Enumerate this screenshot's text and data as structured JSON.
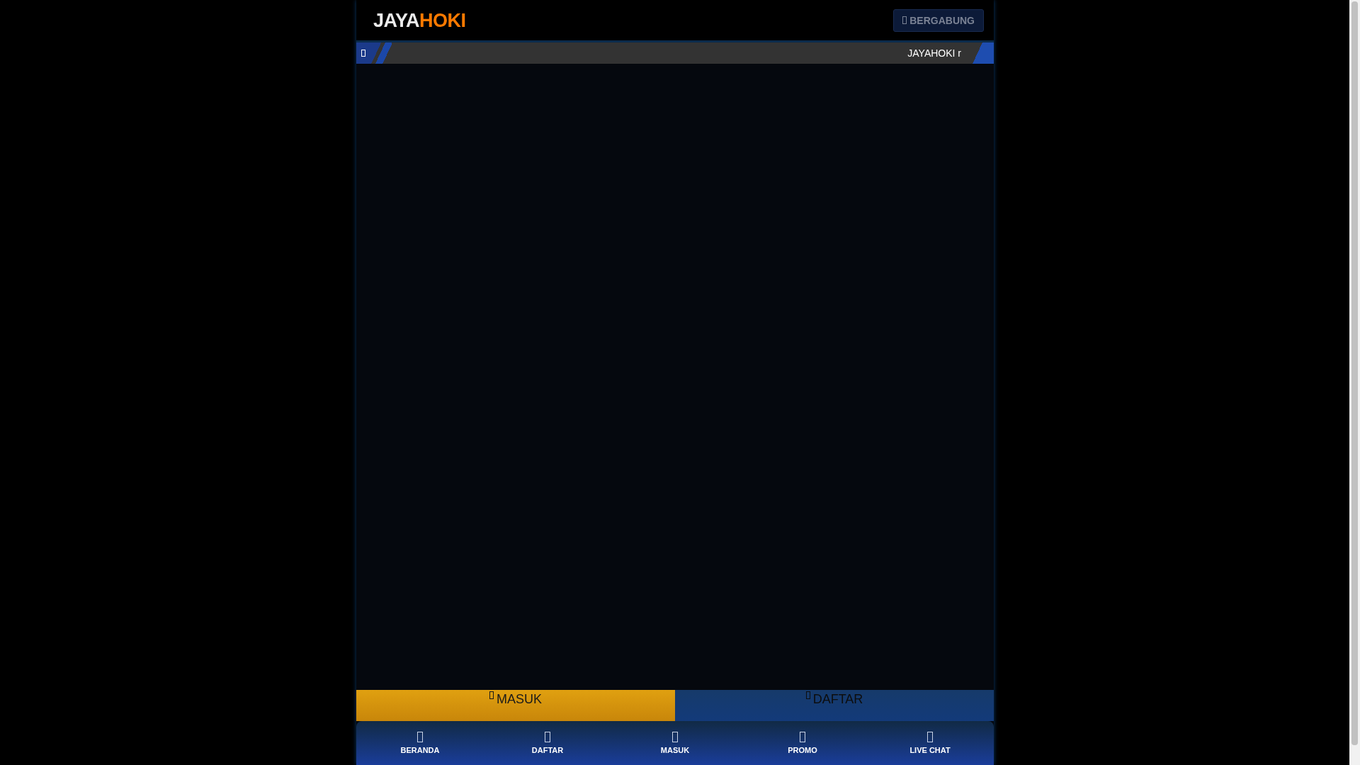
{
  "header": {
    "logo": {
      "part_1": "JAYA",
      "part_2": "HOKI"
    },
    "join_button": {
      "label": "BERGABUNG"
    }
  },
  "ticker": {
    "text": "JAYAHOKI r"
  },
  "action_buttons": [
    {
      "kind": "login",
      "label": "MASUK"
    },
    {
      "kind": "register",
      "label": "DAFTAR"
    }
  ],
  "bottom_nav": [
    {
      "label": "BERANDA"
    },
    {
      "label": "DAFTAR"
    },
    {
      "label": "MASUK"
    },
    {
      "label": "PROMO"
    },
    {
      "label": "LIVE CHAT"
    }
  ]
}
